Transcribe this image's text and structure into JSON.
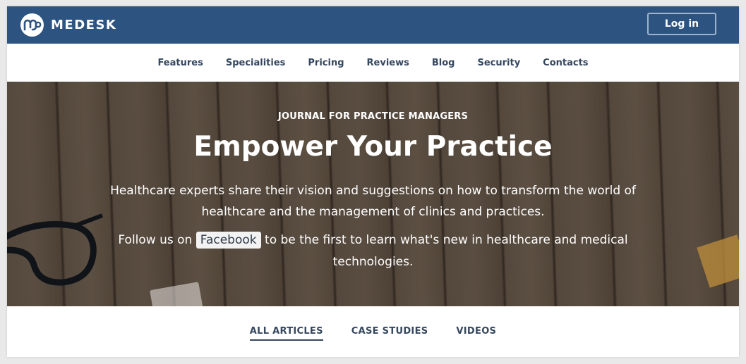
{
  "brand": {
    "name": "MEDESK",
    "logo_icon": "medesk-logo-icon",
    "color": "#2d5480"
  },
  "header": {
    "login_label": "Log in"
  },
  "nav": {
    "items": [
      "Features",
      "Specialities",
      "Pricing",
      "Reviews",
      "Blog",
      "Security",
      "Contacts"
    ]
  },
  "hero": {
    "eyebrow": "JOURNAL FOR PRACTICE MANAGERS",
    "title": "Empower Your Practice",
    "description": "Healthcare experts share their vision and suggestions on how to transform the world of healthcare and the management of clinics and practices.",
    "follow_prefix": "Follow us on",
    "follow_link": "Facebook",
    "follow_suffix": "to be the first to learn what's new in healthcare and medical technologies."
  },
  "tabs": {
    "items": [
      "ALL ARTICLES",
      "CASE STUDIES",
      "VIDEOS"
    ],
    "active": "ALL ARTICLES"
  }
}
